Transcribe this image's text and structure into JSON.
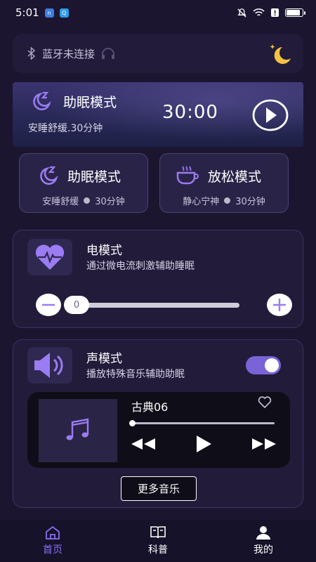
{
  "status_bar": {
    "time": "5:01",
    "app_badge_a": "n",
    "app_badge_b": "Q"
  },
  "bluetooth": {
    "label": "蓝牙未连接"
  },
  "banner": {
    "title": "助眠模式",
    "subtitle": "安睡舒缓.30分钟",
    "timer": "30:00"
  },
  "modes": [
    {
      "name": "助眠模式",
      "desc": "安睡舒缓",
      "duration": "30分钟"
    },
    {
      "name": "放松模式",
      "desc": "静心宁神",
      "duration": "30分钟"
    }
  ],
  "electric_mode": {
    "title": "电模式",
    "desc": "通过微电流刺激辅助睡眠",
    "level": "0",
    "level_value": 0
  },
  "sound_mode": {
    "title": "声模式",
    "desc": "播放特殊音乐辅助助眠",
    "enabled": true,
    "player": {
      "song": "古典06",
      "progress": 0
    },
    "more_label": "更多音乐"
  },
  "tabs": [
    {
      "label": "首页",
      "active": true
    },
    {
      "label": "科普",
      "active": false
    },
    {
      "label": "我的",
      "active": false
    }
  ],
  "colors": {
    "accent": "#8a6ff0",
    "toggle": "#7a63d6",
    "background": "#1b1530"
  }
}
